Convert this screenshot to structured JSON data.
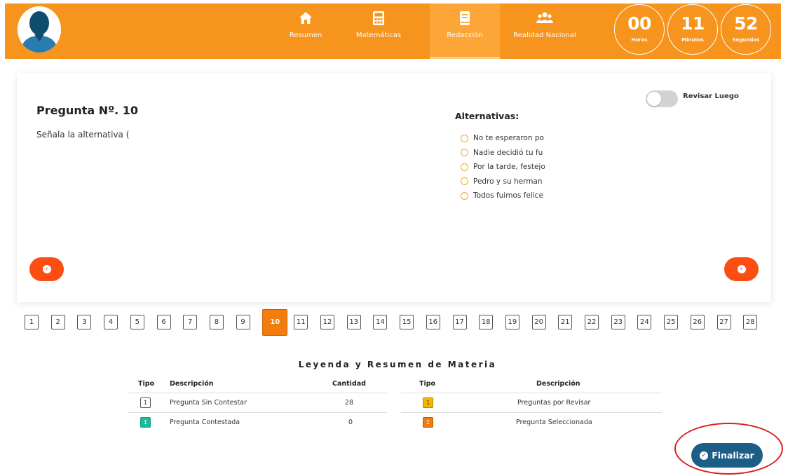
{
  "header": {
    "nav": [
      {
        "label": "Resumen",
        "icon": "home-icon"
      },
      {
        "label": "Matemáticas",
        "icon": "calculator-icon"
      },
      {
        "label": "Redacción",
        "icon": "book-icon"
      },
      {
        "label": "Realidad Nacional",
        "icon": "users-icon"
      }
    ],
    "timer": {
      "hours": "00",
      "hours_label": "Horas",
      "minutes": "11",
      "minutes_label": "Minutos",
      "seconds": "52",
      "seconds_label": "Segundos"
    }
  },
  "question": {
    "title": "Pregunta Nº. 10",
    "text": "Señala la alternativa (",
    "alternatives_title": "Alternativas:",
    "alternatives": [
      "No te esperaron po",
      "Nadie decidió tu fu",
      "Por la tarde, festejo",
      "Pedro y su herman",
      "Todos fuimos felice"
    ],
    "review_label": "Revisar Luego",
    "review_on": false
  },
  "pager": {
    "pages": [
      "1",
      "2",
      "3",
      "4",
      "5",
      "6",
      "7",
      "8",
      "9",
      "10",
      "11",
      "12",
      "13",
      "14",
      "15",
      "16",
      "17",
      "18",
      "19",
      "20",
      "21",
      "22",
      "23",
      "24",
      "25",
      "26",
      "27",
      "28"
    ],
    "current": "10"
  },
  "legend": {
    "title": "Leyenda y Resumen de Materia",
    "left_headers": {
      "tipo": "Tipo",
      "descripcion": "Descripción",
      "cantidad": "Cantidad"
    },
    "right_headers": {
      "tipo": "Tipo",
      "descripcion": "Descripción"
    },
    "left_rows": [
      {
        "tipo": "1",
        "descripcion": "Pregunta Sin Contestar",
        "cantidad": "28"
      },
      {
        "tipo": "1",
        "descripcion": "Pregunta Contestada",
        "cantidad": "0"
      }
    ],
    "right_rows": [
      {
        "tipo": "1",
        "descripcion": "Preguntas por Revisar"
      },
      {
        "tipo": "1",
        "descripcion": "Pregunta Seleccionada"
      }
    ]
  },
  "finalize_label": "Finalizar",
  "colors": {
    "header": "#f7941d",
    "nav_active": "#fba636",
    "arrow_button": "#fc4e12",
    "page_active": "#f27c0e",
    "answered": "#1abc9c",
    "review": "#f4b400",
    "finalize": "#1c5f86",
    "annotation_ring": "#d91e18"
  }
}
